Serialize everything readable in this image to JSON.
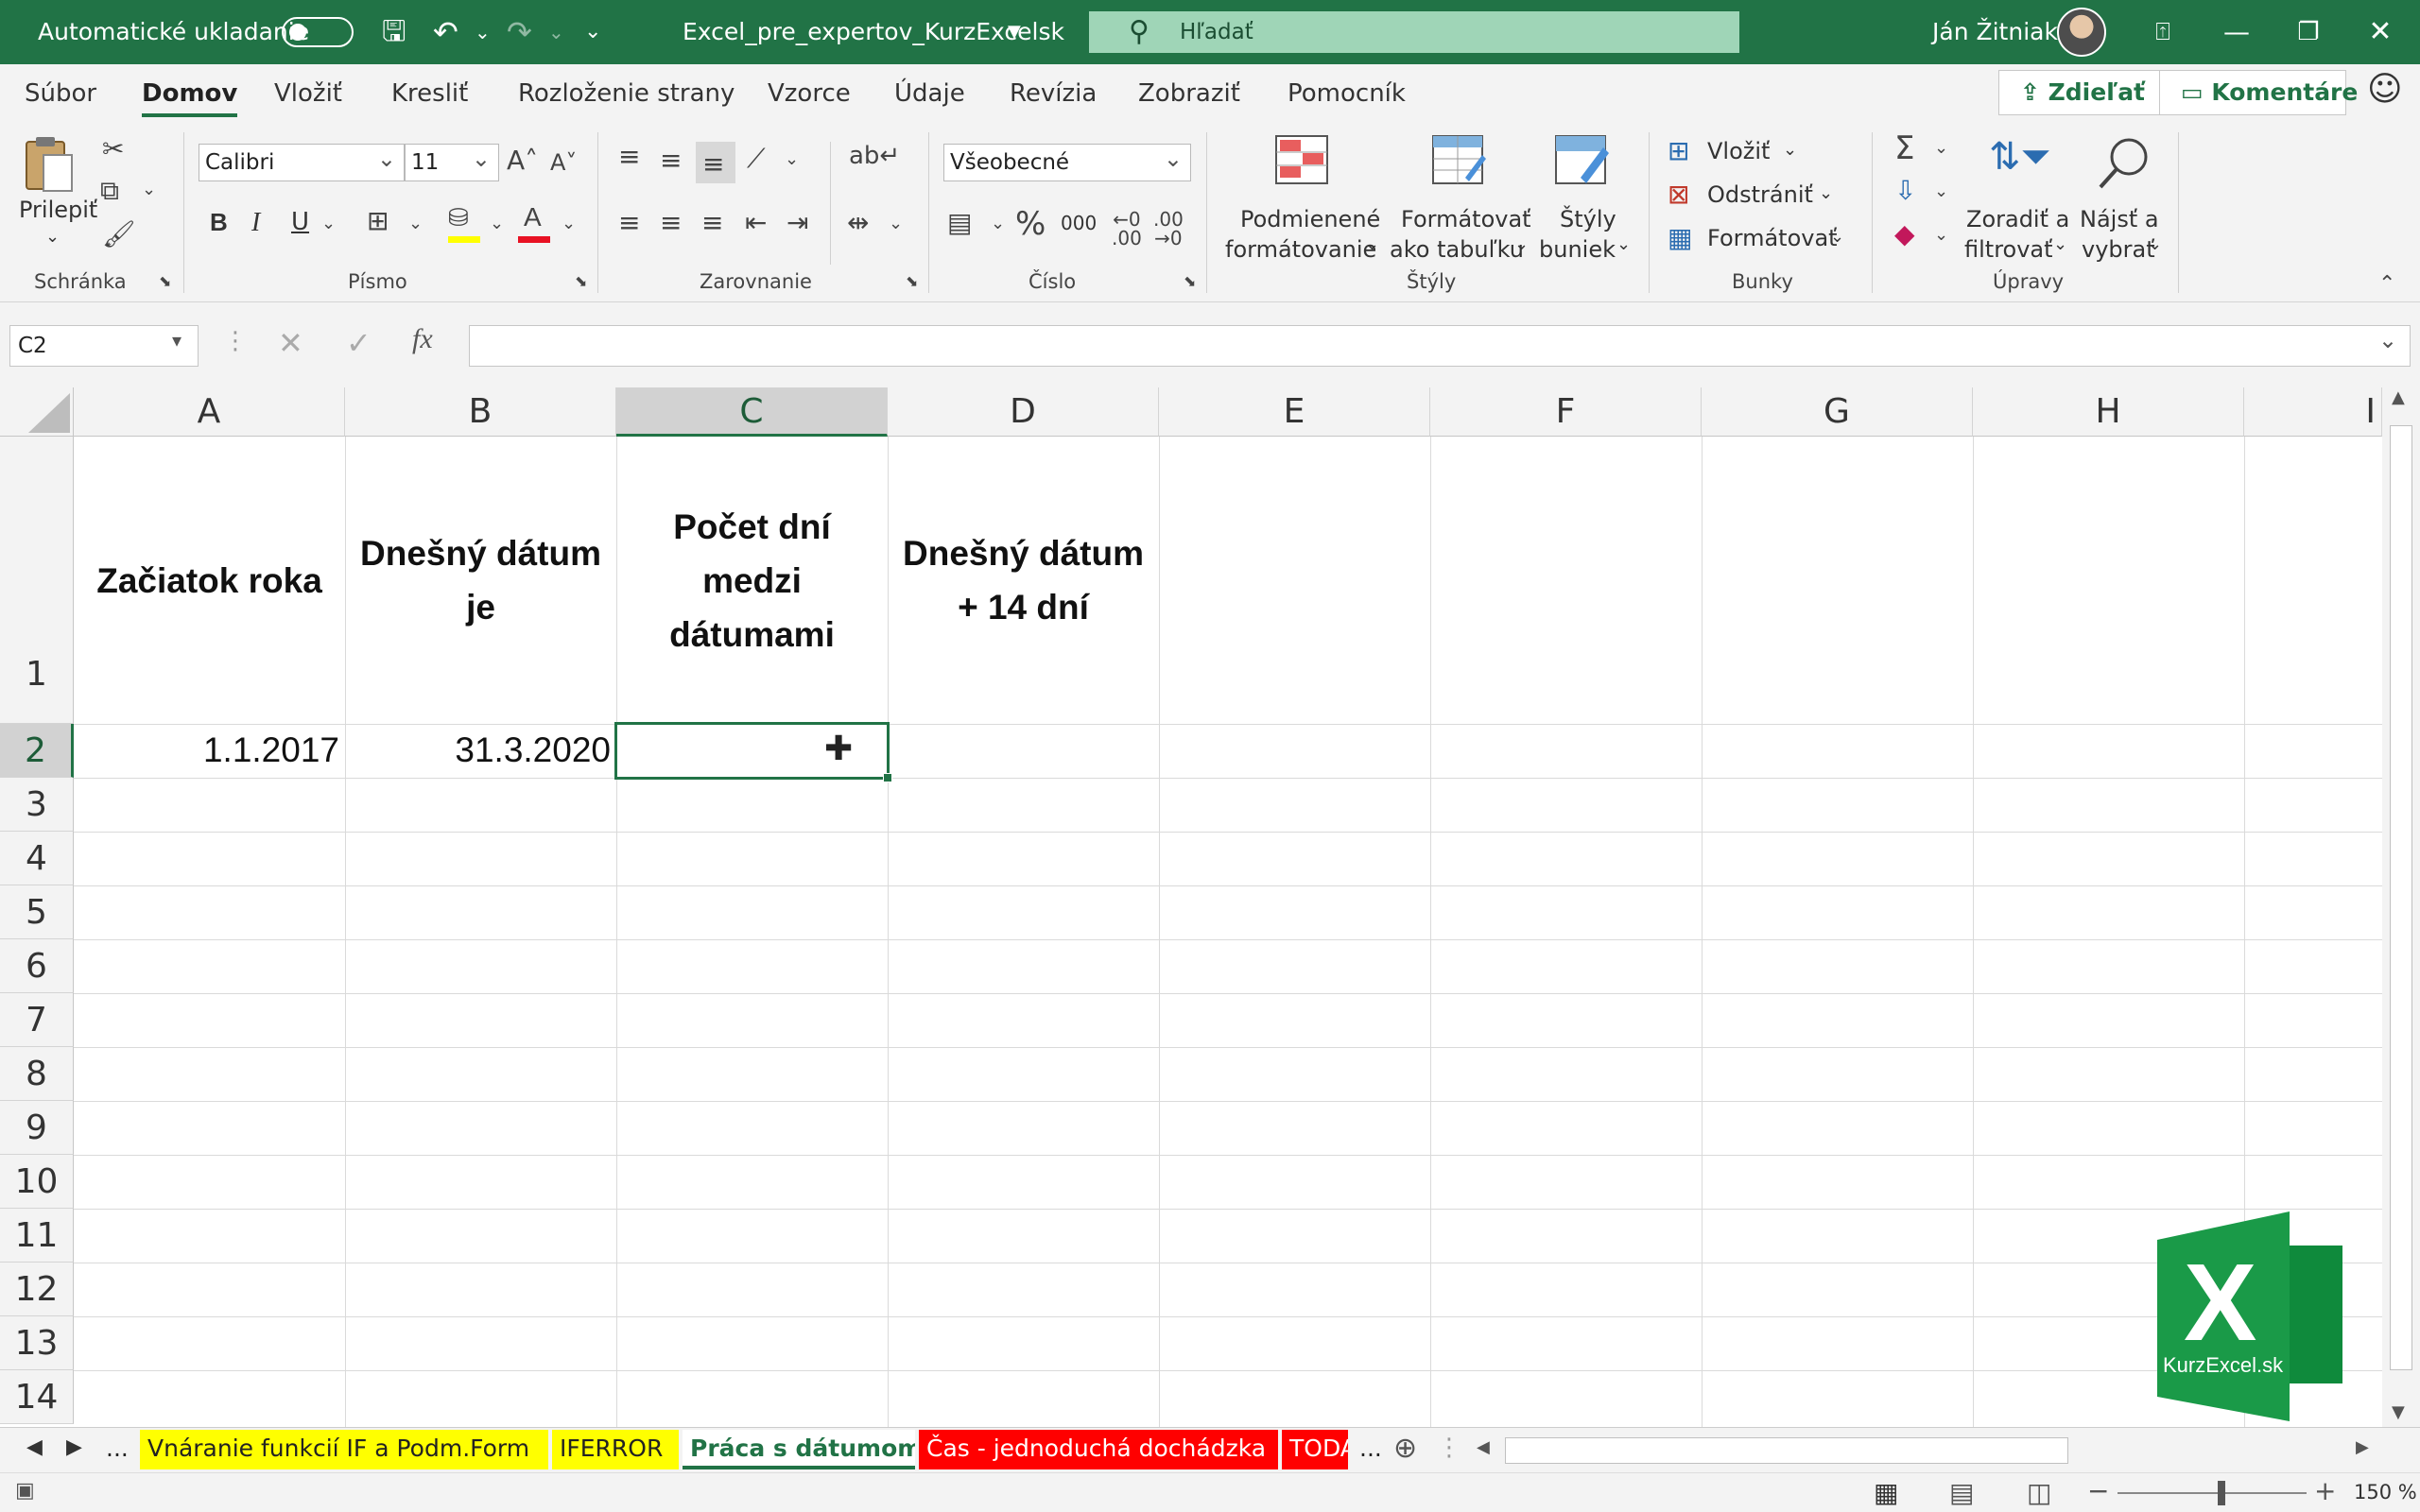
{
  "titlebar": {
    "autosave_label": "Automatické ukladanie",
    "file_name": "Excel_pre_expertov_KurzExcelsk",
    "search_placeholder": "Hľadať",
    "user_name": "Ján Žitniak",
    "bg_color": "#217346"
  },
  "ribbon_tabs": [
    "Súbor",
    "Domov",
    "Vložiť",
    "Kresliť",
    "Rozloženie strany",
    "Vzorce",
    "Údaje",
    "Revízia",
    "Zobraziť",
    "Pomocník"
  ],
  "share_label": "Zdieľať",
  "comments_label": "Komentáre",
  "ribbon": {
    "clipboard": {
      "paste": "Prilepiť",
      "label": "Schránka"
    },
    "font": {
      "name": "Calibri",
      "size": "11",
      "label": "Písmo",
      "bold": "B",
      "italic": "I",
      "underline": "U"
    },
    "alignment": {
      "label": "Zarovnanie"
    },
    "number": {
      "format": "Všeobecné",
      "label": "Číslo",
      "thousands": "000"
    },
    "styles": {
      "conditional_1": "Podmienené",
      "conditional_2": "formátovanie",
      "table_1": "Formátovať",
      "table_2": "ako tabuľku",
      "cell_1": "Štýly",
      "cell_2": "buniek",
      "label": "Štýly"
    },
    "cells": {
      "insert": "Vložiť",
      "delete": "Odstrániť",
      "format": "Formátovať",
      "label": "Bunky"
    },
    "editing": {
      "sort_1": "Zoradiť a",
      "sort_2": "filtrovať",
      "find_1": "Nájsť a",
      "find_2": "vybrať",
      "label": "Úpravy"
    }
  },
  "formula_bar": {
    "name_box": "C2",
    "formula": ""
  },
  "grid": {
    "columns": [
      "A",
      "B",
      "C",
      "D",
      "E",
      "F",
      "G",
      "H",
      "I"
    ],
    "rows": [
      "1",
      "2",
      "3",
      "4",
      "5",
      "6",
      "7",
      "8",
      "9",
      "10",
      "11",
      "12",
      "13",
      "14"
    ],
    "selected_column": "C",
    "selected_row": "2",
    "cells": {
      "A1": "Začiatok roka",
      "B1": "Dnešný dátum je",
      "C1": "Počet dní medzi dátumami",
      "D1": "Dnešný dátum + 14 dní",
      "A2": "1.1.2017",
      "B2": "31.3.2020"
    }
  },
  "sheet_tabs": [
    {
      "name": "...",
      "bg": "#f3f3f3",
      "color": "#222"
    },
    {
      "name": "Vnáranie funkcií IF a Podm.Form",
      "bg": "#ffff00",
      "color": "#222"
    },
    {
      "name": "IFERROR",
      "bg": "#ffff00",
      "color": "#222"
    },
    {
      "name": "Práca s dátumom",
      "bg": "#ffffff",
      "color": "#217346",
      "active": true
    },
    {
      "name": "Čas - jednoduchá dochádzka",
      "bg": "#ff0000",
      "color": "#ffffff"
    },
    {
      "name": "TODA",
      "bg": "#ff0000",
      "color": "#ffffff"
    },
    {
      "name": "...",
      "bg": "#f3f3f3",
      "color": "#222"
    }
  ],
  "status": {
    "zoom": "150 %"
  },
  "watermark": {
    "letter": "X",
    "text": "KurzExcel.sk"
  }
}
